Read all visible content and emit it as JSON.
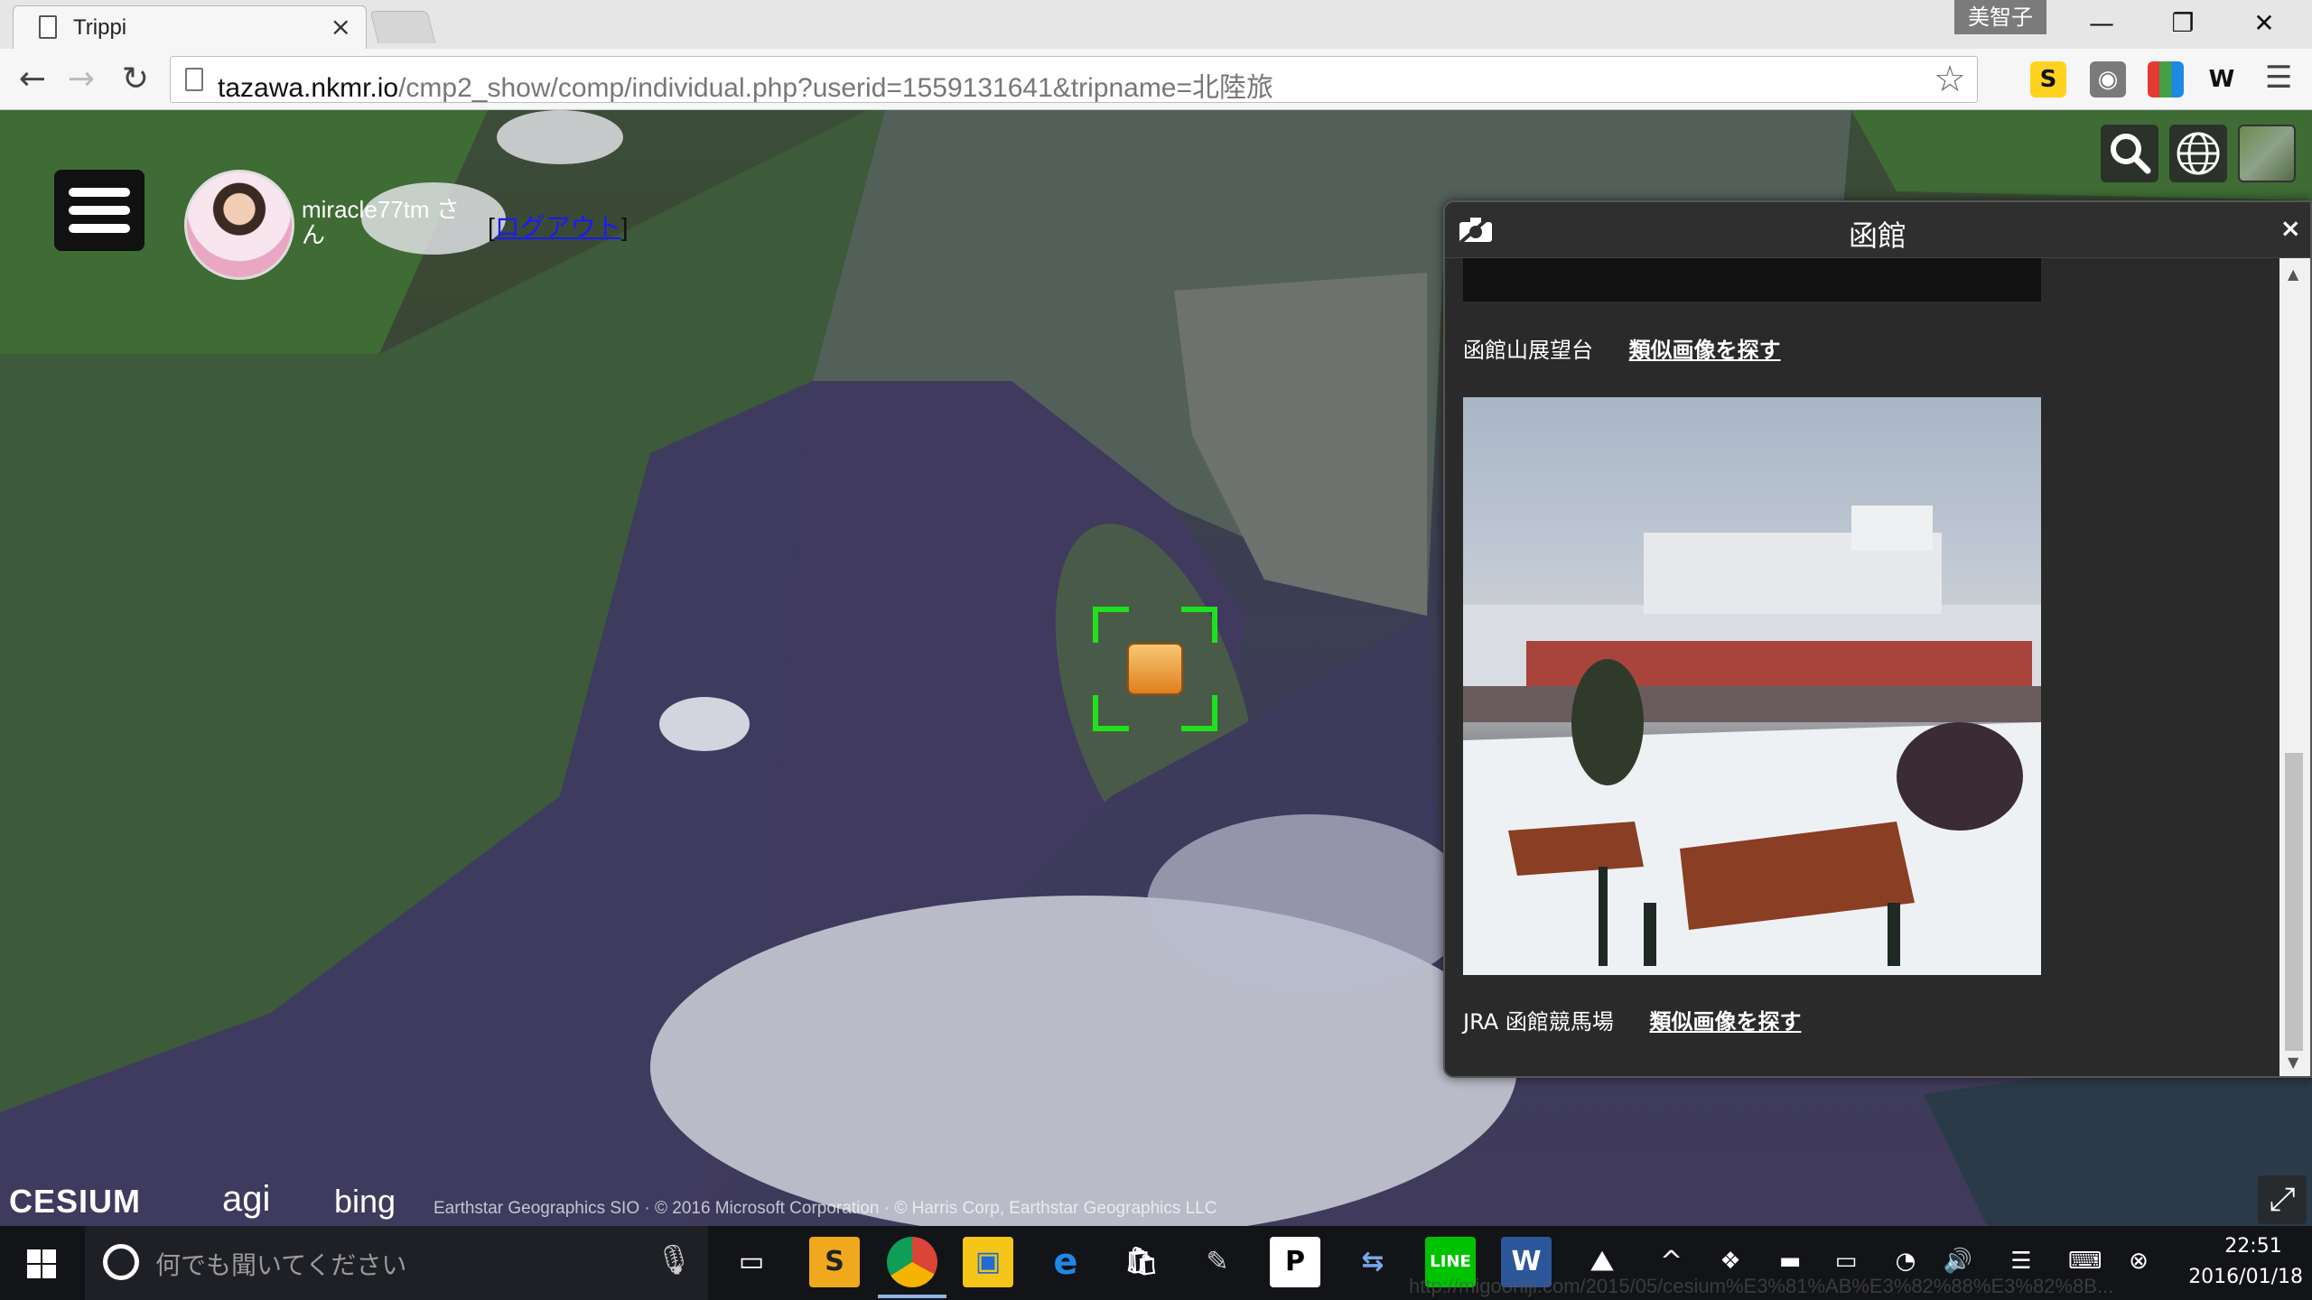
{
  "browser": {
    "tab_title": "Trippi",
    "tab_close": "×",
    "profile_name": "美智子",
    "window_controls": {
      "minimize": "—",
      "restore": "❐",
      "close": "✕"
    },
    "url_host": "tazawa.nkmr.io",
    "url_path": "/cmp2_show/comp/individual.php?userid=1559131641&tripname=北陸旅",
    "extensions": [
      "S",
      "mask-icon",
      "color-icon",
      "W"
    ]
  },
  "map_ui": {
    "user": "miracle77tm さん",
    "logout_label": "ログアウト",
    "credits": {
      "cesium": "CESIUM",
      "agi": "agi",
      "bing": "bing",
      "imagery": "Earthstar Geographics SIO · © 2016 Microsoft Corporation · © Harris Corp, Earthstar Geographics LLC"
    }
  },
  "panel": {
    "title": "函館",
    "close": "×",
    "items": [
      {
        "place": "函館山展望台",
        "similar_link": "類似画像を探す"
      },
      {
        "place": "JRA 函館競馬場",
        "similar_link": "類似画像を探す"
      }
    ]
  },
  "taskbar": {
    "search_placeholder": "何でも聞いてください",
    "time": "22:51",
    "date": "2016/01/18",
    "status_url": "http://migooniji.com/2015/05/cesium%E3%81%AB%E3%82%88%E3%82%8B..."
  }
}
